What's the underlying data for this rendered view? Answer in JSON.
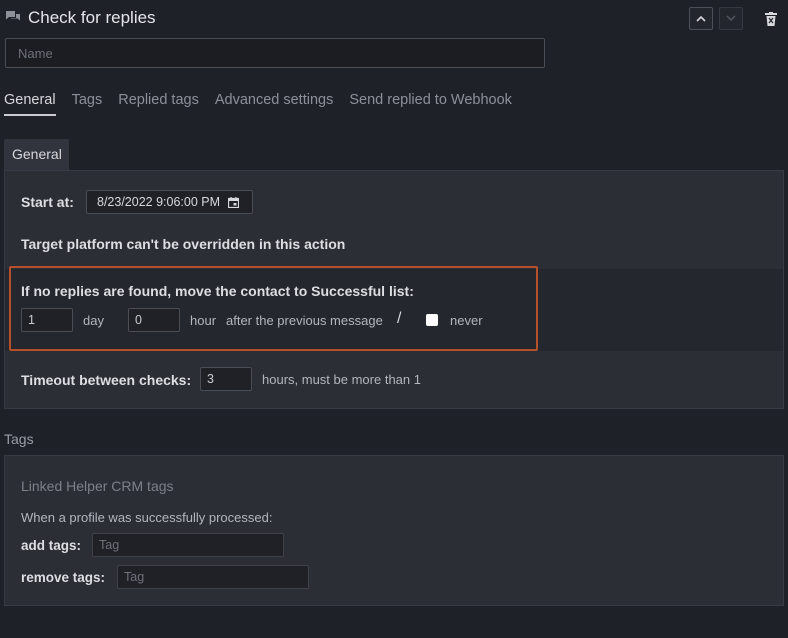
{
  "header": {
    "title": "Check for replies",
    "icon": "chat-bubbles-icon",
    "move_up_icon": "chevron-up-icon",
    "move_down_icon": "chevron-down-icon",
    "delete_icon": "trash-icon"
  },
  "name_field": {
    "placeholder": "Name",
    "value": ""
  },
  "tabs": [
    {
      "label": "General",
      "active": true
    },
    {
      "label": "Tags",
      "active": false
    },
    {
      "label": "Replied tags",
      "active": false
    },
    {
      "label": "Advanced settings",
      "active": false
    },
    {
      "label": "Send replied to Webhook",
      "active": false
    }
  ],
  "general": {
    "section_tab": "General",
    "start_at_label": "Start at:",
    "start_at_value": "8/23/2022 9:06:00 PM",
    "calendar_icon": "calendar-icon",
    "platform_note": "Target platform can't be overridden in this action",
    "no_replies": {
      "label": "If no replies are found, move the contact to Successful list:",
      "days_value": "1",
      "days_unit": "day",
      "hours_value": "0",
      "hours_unit": "hour",
      "after_text": "after the previous message",
      "separator": "/",
      "never_checked": false,
      "never_label": "never"
    },
    "timeout": {
      "label": "Timeout between checks:",
      "value": "3",
      "suffix": "hours, must be more than 1"
    }
  },
  "tags_section": {
    "heading": "Tags",
    "crm_label": "Linked Helper CRM tags",
    "processed_label": "When a profile was successfully processed:",
    "add_label": "add tags:",
    "add_placeholder": "Tag",
    "remove_label": "remove tags:",
    "remove_placeholder": "Tag"
  },
  "colors": {
    "background": "#1e2128",
    "panel": "#2b2e35",
    "highlight_border": "#b4512c",
    "checkbox": "#ffffff"
  }
}
